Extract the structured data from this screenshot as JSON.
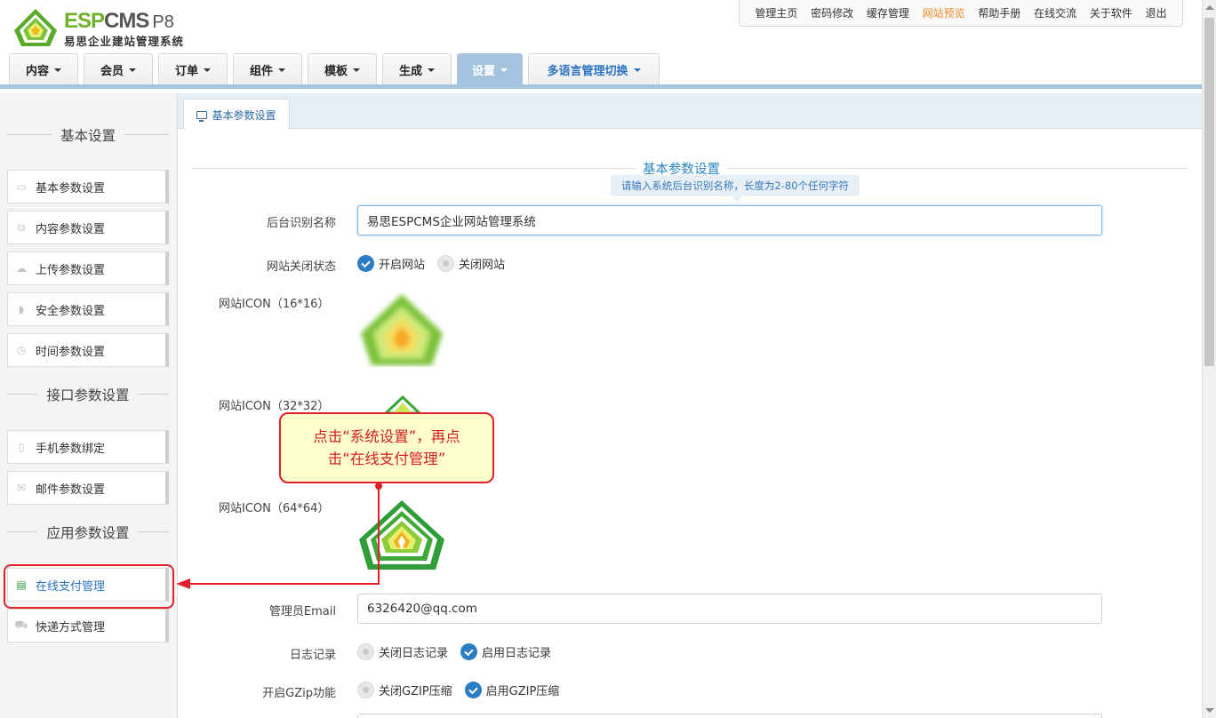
{
  "logo": {
    "brand_esp": "ESP",
    "brand_cms": "CMS",
    "version": "P8",
    "subtitle": "易思企业建站管理系统"
  },
  "toplinks": [
    {
      "label": "管理主页"
    },
    {
      "label": "密码修改"
    },
    {
      "label": "缓存管理"
    },
    {
      "label": "网站预览",
      "active": true
    },
    {
      "label": "帮助手册"
    },
    {
      "label": "在线交流"
    },
    {
      "label": "关于软件"
    },
    {
      "label": "退出"
    }
  ],
  "mainnav": [
    {
      "label": "内容"
    },
    {
      "label": "会员"
    },
    {
      "label": "订单"
    },
    {
      "label": "组件"
    },
    {
      "label": "模板"
    },
    {
      "label": "生成"
    },
    {
      "label": "设置",
      "active": true
    },
    {
      "label": "多语言管理切换"
    }
  ],
  "sidebar": {
    "groups": [
      {
        "title": "基本设置"
      },
      {
        "title": "接口参数设置"
      },
      {
        "title": "应用参数设置"
      }
    ],
    "items": [
      {
        "label": "基本参数设置",
        "icon": "monitor-icon"
      },
      {
        "label": "内容参数设置",
        "icon": "copy-icon"
      },
      {
        "label": "上传参数设置",
        "icon": "cloud-upload-icon"
      },
      {
        "label": "安全参数设置",
        "icon": "shield-icon"
      },
      {
        "label": "时间参数设置",
        "icon": "clock-icon"
      },
      {
        "label": "手机参数绑定",
        "icon": "mobile-icon"
      },
      {
        "label": "邮件参数设置",
        "icon": "envelope-icon"
      },
      {
        "label": "在线支付管理",
        "icon": "credit-card-icon"
      },
      {
        "label": "快递方式管理",
        "icon": "truck-icon"
      }
    ]
  },
  "content": {
    "tab_label": "基本参数设置",
    "section_title": "基本参数设置",
    "tooltip": "请输入系统后台识别名称，长度为2-80个任何字符",
    "fields": {
      "admin_name_label": "后台识别名称",
      "admin_name_value": "易思ESPCMS企业网站管理系统",
      "site_status_label": "网站关闭状态",
      "site_status_opt_on": "开启网站",
      "site_status_opt_off": "关闭网站",
      "icon16_label": "网站ICON（16*16）",
      "icon32_label": "网站ICON（32*32）",
      "icon64_label": "网站ICON（64*64）",
      "email_label": "管理员Email",
      "email_value": "6326420@qq.com",
      "log_label": "日志记录",
      "log_opt_off": "关闭日志记录",
      "log_opt_on": "启用日志记录",
      "gzip_label": "开启GZip功能",
      "gzip_opt_off": "关闭GZIP压缩",
      "gzip_opt_on": "启用GZIP压缩"
    }
  },
  "callout": {
    "line1": "点击“系统设置”，再点",
    "line2": "击“在线支付管理”"
  },
  "colors": {
    "accent": "#2b7cc4",
    "nav_active": "#a3c3de",
    "callout_border": "#e0202a",
    "callout_bg": "#fffecc",
    "logo_green": "#6fb12a"
  }
}
